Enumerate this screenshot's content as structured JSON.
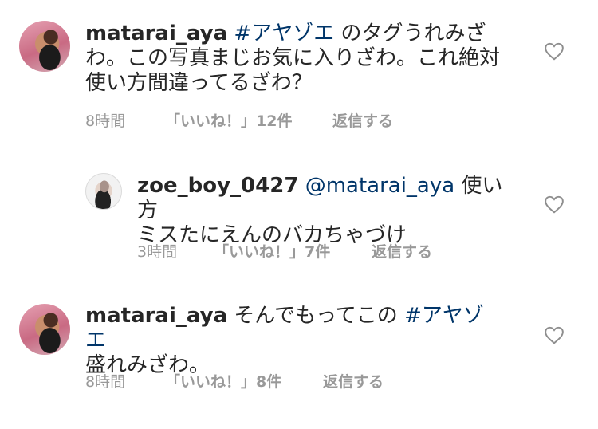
{
  "comments": [
    {
      "username": "matarai_aya",
      "tag": "#アヤゾエ",
      "line1_rest": " のタグうれみざ",
      "line2": "わ。この写真まじお気に入りざわ。これ絶対",
      "line3": "使い方間違ってるざわ？",
      "time": "8時間",
      "likes": "「いいね！」12件",
      "reply": "返信する",
      "heart_icon": "heart-outline-icon"
    },
    {
      "username": "zoe_boy_0427",
      "mention": "@matarai_aya",
      "line1_rest": " 使い方",
      "line2": "ミスたにえんのバカちゃづけ",
      "time": "3時間",
      "likes": "「いいね！」7件",
      "reply": "返信する",
      "heart_icon": "heart-outline-icon"
    },
    {
      "username": "matarai_aya",
      "line1_mid": " そんでもってこの ",
      "tag": "#アヤゾエ",
      "line2": "盛れみざわ。",
      "time": "8時間",
      "likes": "「いいね！」8件",
      "reply": "返信する",
      "heart_icon": "heart-outline-icon"
    }
  ],
  "colors": {
    "text": "#262626",
    "link": "#003569",
    "meta": "#999999",
    "background": "#ffffff"
  }
}
